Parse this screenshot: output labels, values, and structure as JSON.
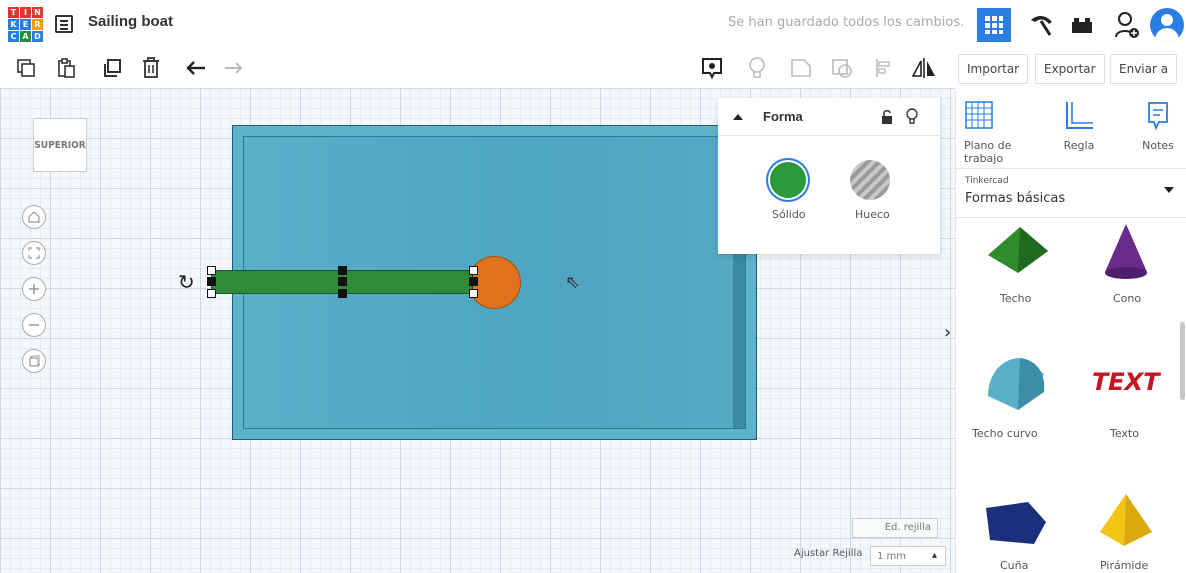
{
  "header": {
    "logo_letters": [
      "T",
      "I",
      "N",
      "K",
      "E",
      "R",
      "C",
      "A",
      "D"
    ],
    "logo_colors": [
      "#e2352b",
      "#e2352b",
      "#e2352b",
      "#2a7de1",
      "#2a7de1",
      "#f39c12",
      "#2a7de1",
      "#2f8b3a",
      "#2a7de1"
    ],
    "project_title": "Sailing boat",
    "save_status": "Se han guardado todos los cambios."
  },
  "toolbar": {
    "import_label": "Importar",
    "export_label": "Exportar",
    "send_label": "Enviar a"
  },
  "canvas": {
    "viewcube_label": "SUPERIOR",
    "box_color": "#5db3cc",
    "mast_color": "#2f8b3a",
    "ball_color": "#e0721c"
  },
  "shape_panel": {
    "title": "Forma",
    "solid_label": "Sólido",
    "hole_label": "Hueco",
    "solid_color": "#2a9a3a"
  },
  "library": {
    "tools": [
      {
        "label": "Plano de trabajo"
      },
      {
        "label": "Regla"
      },
      {
        "label": "Notes"
      }
    ],
    "category_source": "Tinkercad",
    "category": "Formas básicas",
    "shapes": [
      {
        "name": "Techo",
        "color": "#2e8b2e"
      },
      {
        "name": "Cono",
        "color": "#6a2a8a"
      },
      {
        "name": "Techo curvo",
        "color": "#5aafc9"
      },
      {
        "name": "Texto",
        "color": "#c8141e"
      },
      {
        "name": "Cuña",
        "color": "#1b2f7a"
      },
      {
        "name": "Pirámide",
        "color": "#e8b511"
      }
    ],
    "texto_glyph": "TEXT"
  },
  "footer": {
    "edit_grid_label": "Ed. rejilla",
    "snap_label": "Ajustar Rejilla",
    "snap_value": "1 mm"
  }
}
